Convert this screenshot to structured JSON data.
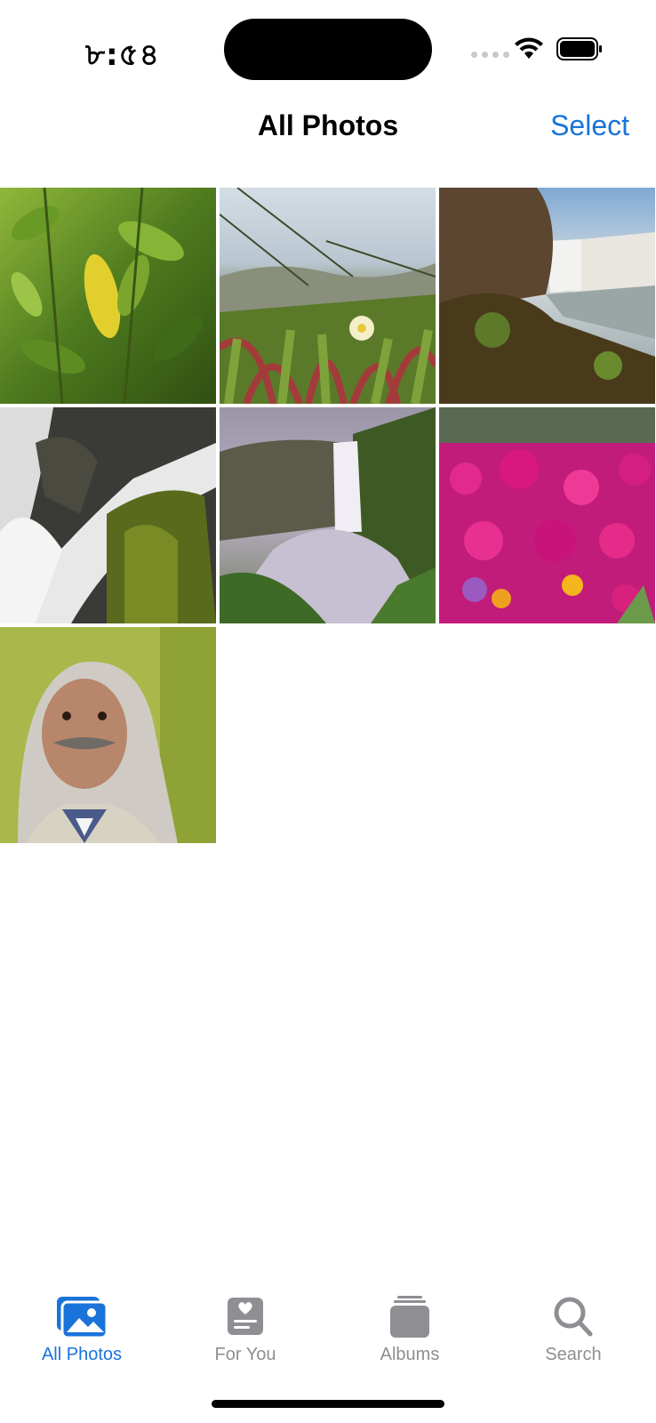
{
  "status_bar": {
    "time": "৮:৫৪",
    "icons": [
      "signal-icon",
      "wifi-icon",
      "battery-icon"
    ]
  },
  "nav": {
    "title": "All Photos",
    "select_label": "Select"
  },
  "photos": [
    {
      "name": "green-leaves-photo"
    },
    {
      "name": "ice-plant-flower-photo"
    },
    {
      "name": "waterfall-cliff-photo"
    },
    {
      "name": "waterfall-rocks-photo"
    },
    {
      "name": "misty-waterfall-photo"
    },
    {
      "name": "pink-flowers-photo"
    },
    {
      "name": "man-portrait-photo"
    }
  ],
  "tabs": [
    {
      "label": "All Photos",
      "icon": "photos-icon",
      "active": true
    },
    {
      "label": "For You",
      "icon": "for-you-icon",
      "active": false
    },
    {
      "label": "Albums",
      "icon": "albums-icon",
      "active": false
    },
    {
      "label": "Search",
      "icon": "search-icon",
      "active": false
    }
  ],
  "colors": {
    "accent": "#1a73d9",
    "inactive": "#8e8e93"
  }
}
